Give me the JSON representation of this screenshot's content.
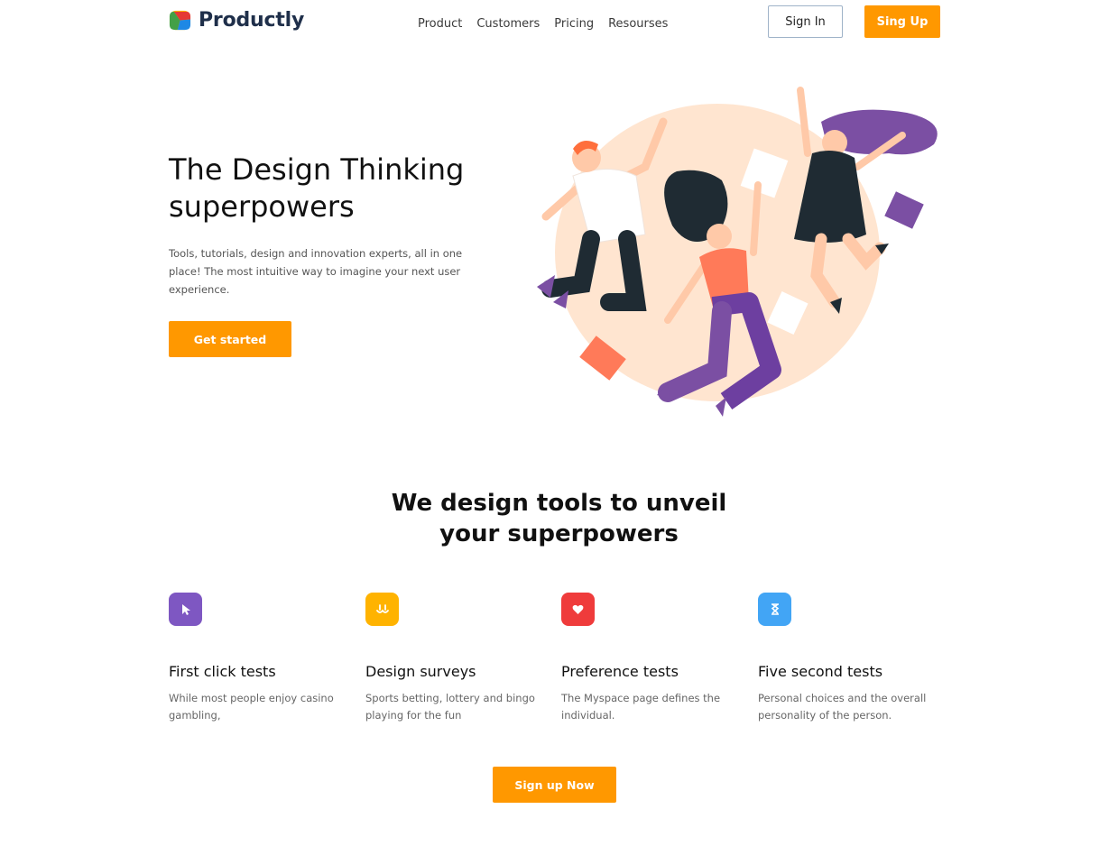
{
  "brand": {
    "name": "Productly"
  },
  "nav": {
    "items": [
      {
        "label": "Product"
      },
      {
        "label": "Customers"
      },
      {
        "label": "Pricing"
      },
      {
        "label": "Resourses"
      }
    ]
  },
  "header": {
    "signin_label": "Sign In",
    "signup_label": "Sing Up"
  },
  "hero": {
    "title": "The Design Thinking superpowers",
    "subtitle": "Tools, tutorials, design and innovation experts, all in one place! The most intuitive way to imagine your next user experience.",
    "cta_label": "Get started"
  },
  "section": {
    "title_line1": "We design tools to unveil",
    "title_line2": "your superpowers"
  },
  "features": [
    {
      "title": "First click tests",
      "text": "While most people enjoy casino gambling,",
      "color": "#7e57c2",
      "icon": "cursor-icon"
    },
    {
      "title": "Design surveys",
      "text": "Sports betting, lottery and bingo playing for the fun",
      "color": "#ffb300",
      "icon": "survey-icon"
    },
    {
      "title": "Preference tests",
      "text": "The Myspace page defines the individual.",
      "color": "#ef3b3b",
      "icon": "heart-icon"
    },
    {
      "title": "Five second tests",
      "text": "Personal choices and the overall personality of the person.",
      "color": "#42a5f5",
      "icon": "hourglass-icon"
    }
  ],
  "footer_cta": {
    "label": "Sign up Now"
  },
  "colors": {
    "accent": "#ff9800",
    "brand_text": "#1f2f4a"
  }
}
